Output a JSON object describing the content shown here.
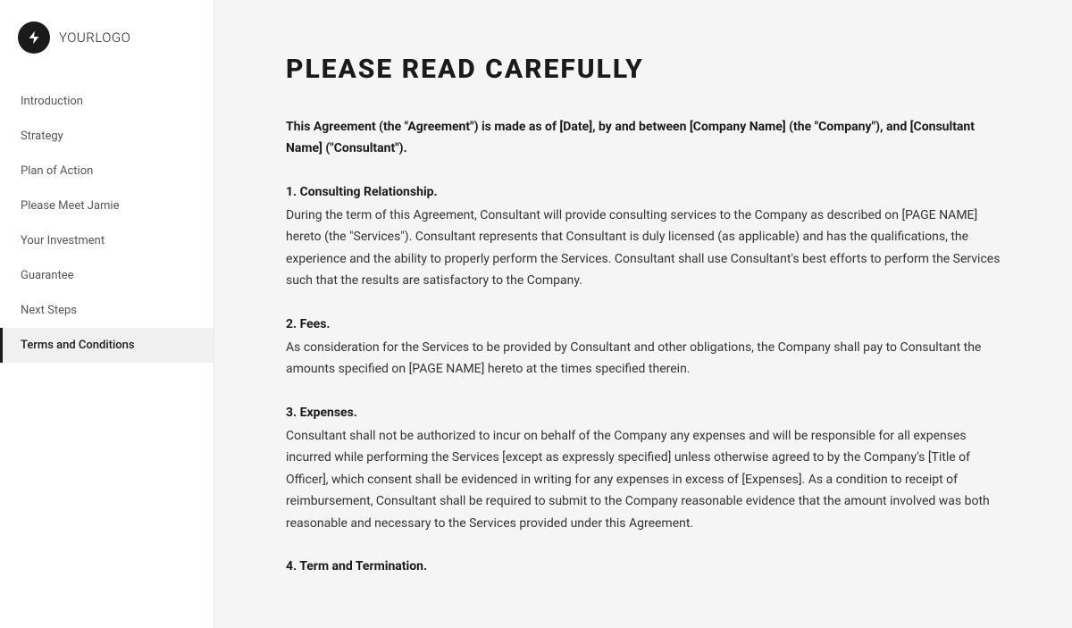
{
  "logo": {
    "text_bold": "YOUR",
    "text_light": "LOGO"
  },
  "sidebar": {
    "items": [
      {
        "id": "introduction",
        "label": "Introduction",
        "active": false
      },
      {
        "id": "strategy",
        "label": "Strategy",
        "active": false
      },
      {
        "id": "plan-of-action",
        "label": "Plan of Action",
        "active": false
      },
      {
        "id": "please-meet-jamie",
        "label": "Please Meet Jamie",
        "active": false
      },
      {
        "id": "your-investment",
        "label": "Your Investment",
        "active": false
      },
      {
        "id": "guarantee",
        "label": "Guarantee",
        "active": false
      },
      {
        "id": "next-steps",
        "label": "Next Steps",
        "active": false
      },
      {
        "id": "terms-and-conditions",
        "label": "Terms and Conditions",
        "active": true
      }
    ]
  },
  "main": {
    "page_title": "PLEASE READ CAREFULLY",
    "intro_text": "This Agreement (the \"Agreement\") is made as of [Date], by and between [Company Name] (the \"Company\"), and [Consultant Name] (\"Consultant\").",
    "sections": [
      {
        "id": "consulting-relationship",
        "title": "1. Consulting Relationship.",
        "body": "During the term of this Agreement, Consultant will provide consulting services to the Company as described on [PAGE NAME] hereto (the \"Services\"). Consultant represents that Consultant is duly licensed (as applicable) and has the qualifications, the experience and the ability to properly perform the Services. Consultant shall use Consultant's best efforts to perform the Services such that the results are satisfactory to the Company."
      },
      {
        "id": "fees",
        "title": "2. Fees.",
        "body": "As consideration for the Services to be provided by Consultant and other obligations, the Company shall pay to Consultant the amounts specified on [PAGE NAME] hereto at the times specified therein."
      },
      {
        "id": "expenses",
        "title": "3. Expenses.",
        "body": "Consultant shall not be authorized to incur on behalf of the Company any expenses and will be responsible for all expenses incurred while performing the Services [except as expressly specified] unless otherwise agreed to by the Company's [Title of Officer], which consent shall be evidenced in writing for any expenses in excess of [Expenses]. As a condition to receipt of reimbursement, Consultant shall be required to submit to the Company reasonable evidence that the amount involved was both reasonable and necessary to the Services provided under this Agreement."
      },
      {
        "id": "term-and-termination",
        "title": "4. Term and Termination.",
        "body": ""
      }
    ]
  }
}
